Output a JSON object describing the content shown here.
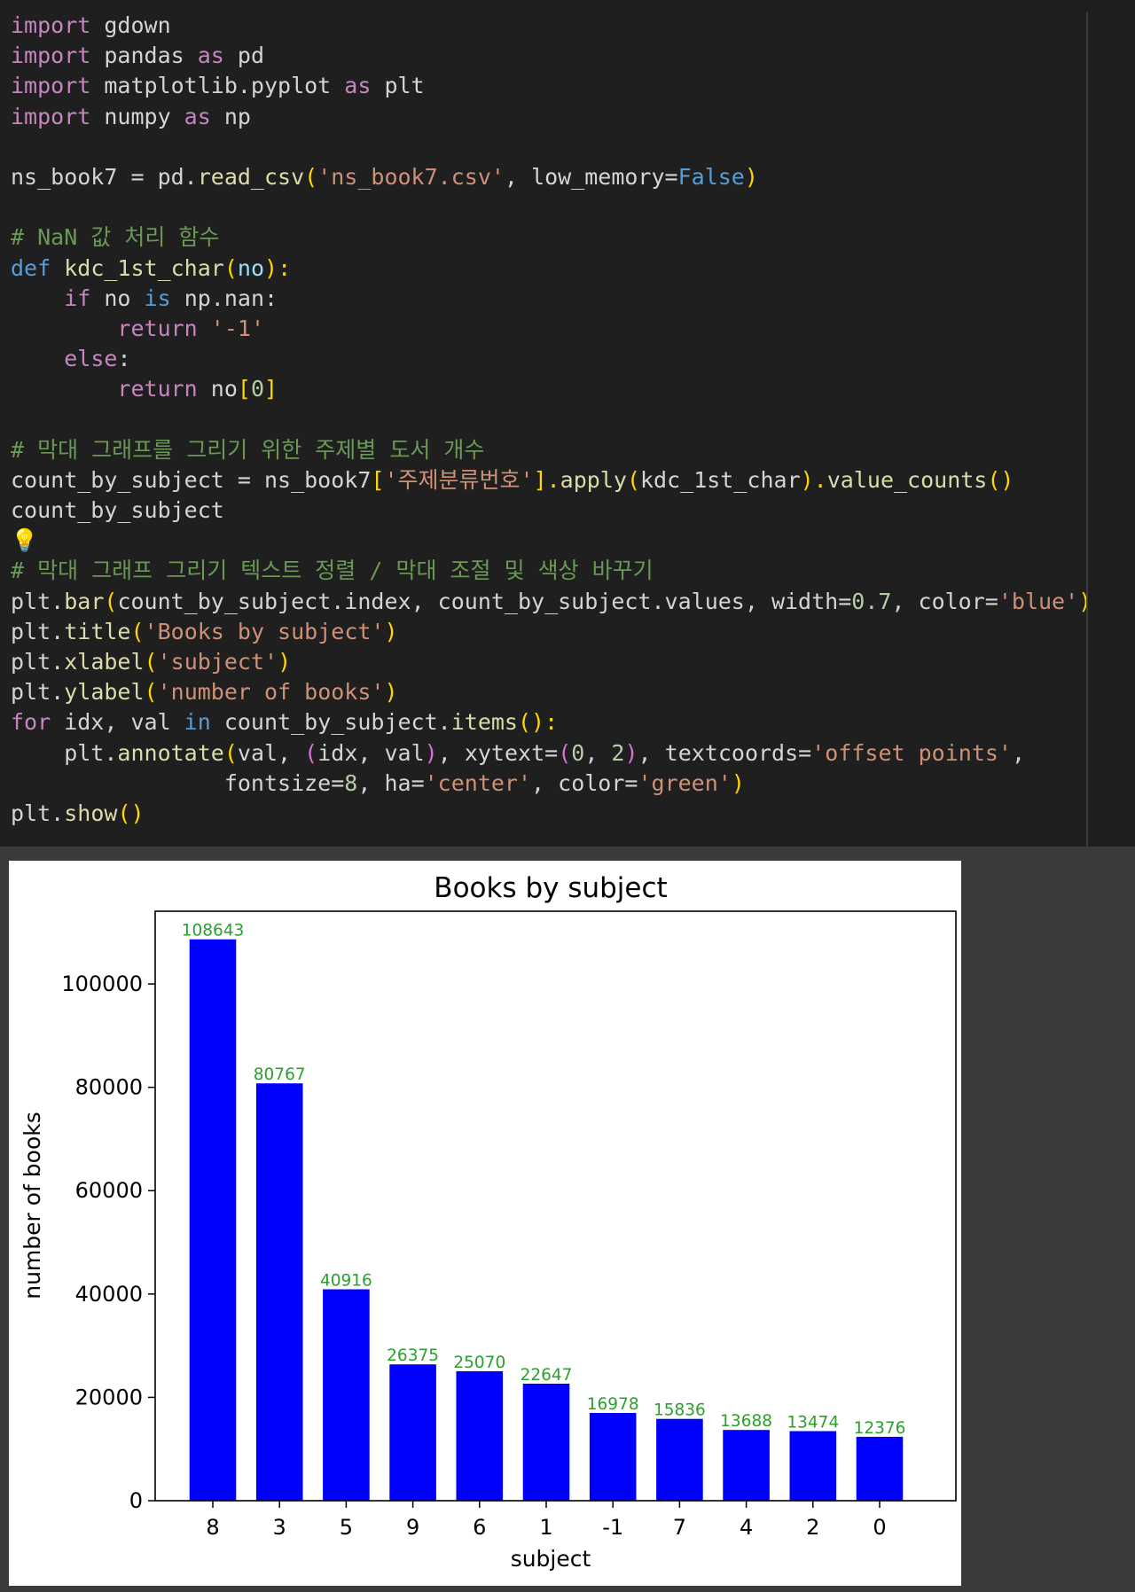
{
  "code_cell": {
    "line_01": [
      "import",
      " gdown"
    ],
    "line_02": [
      "import",
      " pandas ",
      "as",
      " pd"
    ],
    "line_03": [
      "import",
      " matplotlib.pyplot ",
      "as",
      " plt"
    ],
    "line_04": [
      "import",
      " numpy ",
      "as",
      " np"
    ],
    "line_06": [
      "ns_book7 = pd.",
      "read_csv",
      "(",
      "'ns_book7.csv'",
      ", low_memory=",
      "False",
      ")"
    ],
    "line_08": "# NaN 값 처리 함수",
    "line_09": [
      "def",
      " ",
      "kdc_1st_char",
      "(",
      "no",
      "):"
    ],
    "line_10": [
      "    ",
      "if",
      " no ",
      "is",
      " np.nan:"
    ],
    "line_11": [
      "        ",
      "return",
      " ",
      "'-1'"
    ],
    "line_12": [
      "    ",
      "else",
      ":"
    ],
    "line_13": [
      "        ",
      "return",
      " no",
      "[",
      "0",
      "]"
    ],
    "line_15": "# 막대 그래프를 그리기 위한 주제별 도서 개수",
    "line_16": [
      "count_by_subject = ns_book7",
      "[",
      "'주제분류번호'",
      "].",
      "apply",
      "(",
      "kdc_1st_char",
      ").",
      "value_counts",
      "()"
    ],
    "line_17": "count_by_subject",
    "line_18_icon": "lightbulb-icon",
    "line_19": "# 막대 그래프 그리기 텍스트 정렬 / 막대 조절 및 색상 바꾸기",
    "line_20": [
      "plt.",
      "bar",
      "(",
      "count_by_subject.index, count_by_subject.values, width=",
      "0.7",
      ", color=",
      "'blue'",
      ")"
    ],
    "line_21": [
      "plt.",
      "title",
      "(",
      "'Books by subject'",
      ")"
    ],
    "line_22": [
      "plt.",
      "xlabel",
      "(",
      "'subject'",
      ")"
    ],
    "line_23": [
      "plt.",
      "ylabel",
      "(",
      "'number of books'",
      ")"
    ],
    "line_24": [
      "for",
      " idx, val ",
      "in",
      " count_by_subject.",
      "items",
      "():"
    ],
    "line_25": [
      "    plt.",
      "annotate",
      "(",
      "val, ",
      "(",
      "idx, val",
      ")",
      ", xytext=",
      "(",
      "0",
      ", ",
      "2",
      ")",
      ", textcoords=",
      "'offset points'",
      ","
    ],
    "line_26": [
      "                fontsize=",
      "8",
      ", ha=",
      "'center'",
      ", color=",
      "'green'",
      ")"
    ],
    "line_27": [
      "plt.",
      "show",
      "()"
    ]
  },
  "colors": {
    "editor_background": "#1f1f1f",
    "output_background": "#ffffff",
    "bar": "#0000ff",
    "data_label": "#2ca02c"
  },
  "chart_data": {
    "type": "bar",
    "title": "Books by subject",
    "xlabel": "subject",
    "ylabel": "number of books",
    "categories": [
      "8",
      "3",
      "5",
      "9",
      "6",
      "1",
      "-1",
      "7",
      "4",
      "2",
      "0"
    ],
    "values": [
      108643,
      80767,
      40916,
      26375,
      25070,
      22647,
      16978,
      15836,
      13688,
      13474,
      12376
    ],
    "data_labels": [
      "108643",
      "80767",
      "40916",
      "26375",
      "25070",
      "22647",
      "16978",
      "15836",
      "13688",
      "13474",
      "12376"
    ],
    "yticks": [
      0,
      20000,
      40000,
      60000,
      80000,
      100000
    ],
    "ytick_labels": [
      "0",
      "20000",
      "40000",
      "60000",
      "80000",
      "100000"
    ],
    "ylim": [
      0,
      114075
    ],
    "bar_width": 0.7,
    "grid": false,
    "legend": "none"
  }
}
